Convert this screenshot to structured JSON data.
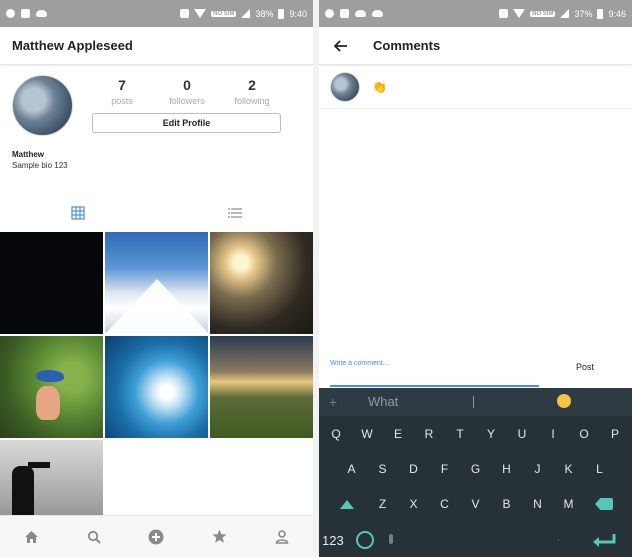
{
  "left_phone": {
    "status": {
      "battery": "38%",
      "time": "9:40",
      "network_tag": "NO SIM"
    },
    "appbar": {
      "title": "Matthew Appleseed"
    },
    "profile": {
      "stats": [
        {
          "value": "7",
          "label": "posts"
        },
        {
          "value": "0",
          "label": "followers"
        },
        {
          "value": "2",
          "label": "following"
        }
      ],
      "edit_button": "Edit Profile",
      "name": "Matthew",
      "bio": "Sample bio 123"
    },
    "view_tabs": {
      "grid_icon": "grid-icon",
      "list_icon": "list-icon",
      "active": "grid"
    },
    "grid_count": 7,
    "bottom_nav": [
      "home-icon",
      "search-icon",
      "add-circle-icon",
      "star-icon",
      "person-icon"
    ]
  },
  "right_phone": {
    "status": {
      "battery": "37%",
      "time": "9:46",
      "network_tag": "NO SIM"
    },
    "appbar": {
      "title": "Comments"
    },
    "comment": {
      "text": "👏"
    },
    "composer": {
      "placeholder": "Write a comment...",
      "post_label": "Post"
    },
    "keyboard": {
      "suggestion_word": "What",
      "row1": [
        "Q",
        "W",
        "E",
        "R",
        "T",
        "Y",
        "U",
        "I",
        "O",
        "P"
      ],
      "row2": [
        "A",
        "S",
        "D",
        "F",
        "G",
        "H",
        "J",
        "K",
        "L"
      ],
      "row3": [
        "Z",
        "X",
        "C",
        "V",
        "B",
        "N",
        "M"
      ],
      "numbers_key": "123"
    }
  },
  "colors": {
    "accent": "#4a90d6",
    "keyboard_bg": "#263238",
    "keyboard_accent": "#56c6b5"
  }
}
